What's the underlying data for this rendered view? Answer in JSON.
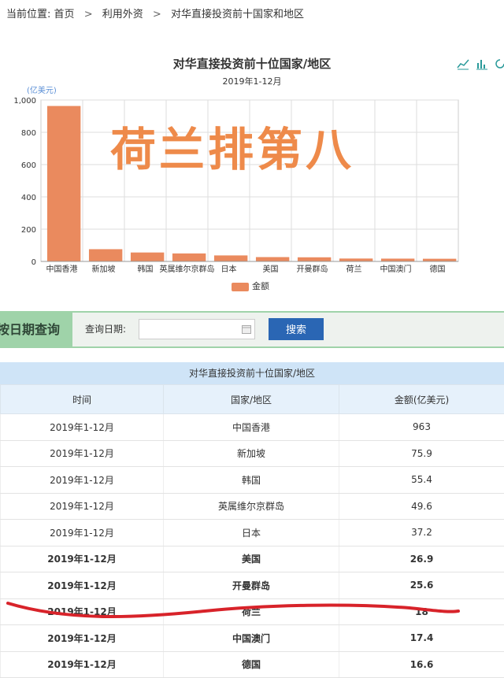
{
  "breadcrumb": {
    "prefix": "当前位置:",
    "items": [
      "首页",
      "利用外资",
      "对华直接投资前十国家和地区"
    ],
    "sep": ">"
  },
  "chart": {
    "tools": {
      "line_icon": "line-chart-icon",
      "bar_icon": "bar-chart-icon"
    },
    "overlay_text": "荷兰排第八",
    "legend_label": "金额"
  },
  "chart_data": {
    "type": "bar",
    "title": "对华直接投资前十位国家/地区",
    "subtitle": "2019年1-12月",
    "ylabel": "(亿美元)",
    "ylim": [
      0,
      1000
    ],
    "yticks": [
      0,
      200,
      400,
      600,
      800,
      1000
    ],
    "ytick_labels": [
      "0",
      "200",
      "400",
      "600",
      "800",
      "1,000"
    ],
    "categories": [
      "中国香港",
      "新加坡",
      "韩国",
      "英属维尔京群岛",
      "日本",
      "美国",
      "开曼群岛",
      "荷兰",
      "中国澳门",
      "德国"
    ],
    "series": [
      {
        "name": "金额",
        "values": [
          963,
          75.9,
          55.4,
          49.6,
          37.2,
          26.9,
          25.6,
          18,
          17.4,
          16.6
        ],
        "color": "#ea8a5e"
      }
    ],
    "grid": true,
    "legend": "bottom"
  },
  "query": {
    "title": "按日期查询",
    "label": "查询日期:",
    "input_value": "",
    "button": "搜索"
  },
  "table": {
    "caption": "对华直接投资前十位国家/地区",
    "headers": [
      "时间",
      "国家/地区",
      "金额(亿美元)"
    ],
    "rows": [
      [
        "2019年1-12月",
        "中国香港",
        "963"
      ],
      [
        "2019年1-12月",
        "新加坡",
        "75.9"
      ],
      [
        "2019年1-12月",
        "韩国",
        "55.4"
      ],
      [
        "2019年1-12月",
        "英属维尔京群岛",
        "49.6"
      ],
      [
        "2019年1-12月",
        "日本",
        "37.2"
      ],
      [
        "2019年1-12月",
        "美国",
        "26.9"
      ],
      [
        "2019年1-12月",
        "开曼群岛",
        "25.6"
      ],
      [
        "2019年1-12月",
        "荷兰",
        "18"
      ],
      [
        "2019年1-12月",
        "中国澳门",
        "17.4"
      ],
      [
        "2019年1-12月",
        "德国",
        "16.6"
      ]
    ],
    "bold_from_index": 5
  },
  "colors": {
    "bar": "#ea8a5e",
    "accent": "#2a66b4",
    "query_bg": "#9fd3a9",
    "highlight": "#d8232a"
  }
}
